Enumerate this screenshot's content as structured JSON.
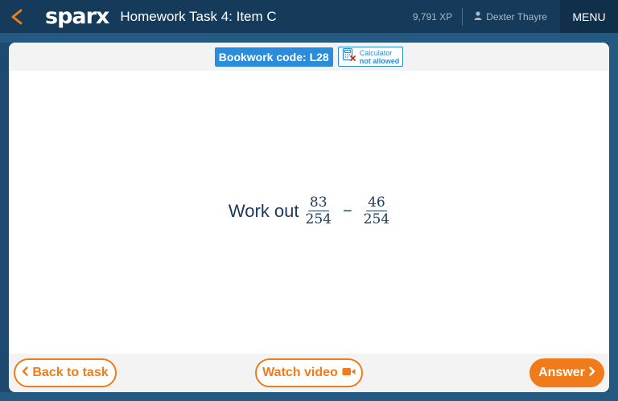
{
  "topbar": {
    "logo": "sparx",
    "title": "Homework Task 4: Item C",
    "xp": "9,791 XP",
    "user": "Dexter Thayre",
    "menu_label": "MENU"
  },
  "card": {
    "bookwork": "Bookwork code: L28",
    "calculator_line1": "Calculator",
    "calculator_line2": "not allowed"
  },
  "question": {
    "prefix": "Work out",
    "fraction1": {
      "numerator": "83",
      "denominator": "254"
    },
    "operator": "−",
    "fraction2": {
      "numerator": "46",
      "denominator": "254"
    }
  },
  "footer": {
    "back_label": "Back to task",
    "video_label": "Watch video",
    "answer_label": "Answer"
  },
  "colors": {
    "accent": "#f07b1a",
    "blue": "#2a8ddc",
    "navy": "#163a5a"
  }
}
